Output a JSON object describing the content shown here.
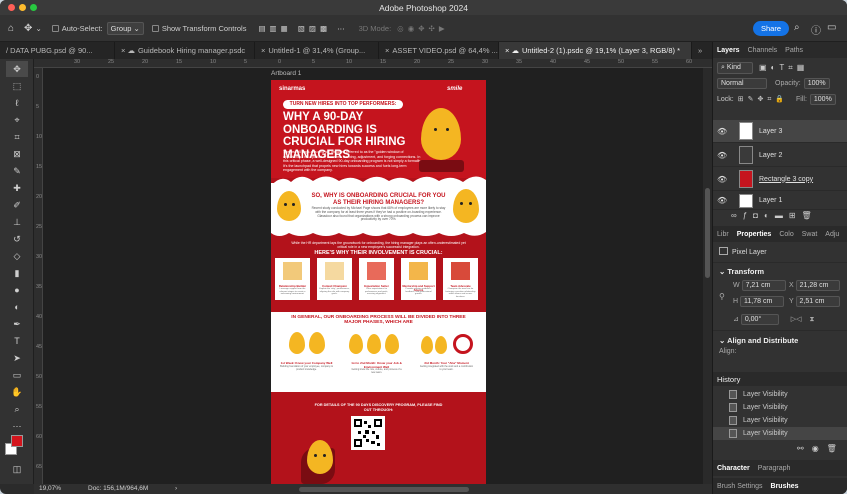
{
  "window": {
    "title": "Adobe Photoshop 2024"
  },
  "options_bar": {
    "auto_select_label": "Auto-Select:",
    "auto_select_value": "Group",
    "transform_label": "Show Transform Controls",
    "mode_3d": "3D Mode:",
    "share_label": "Share"
  },
  "tabs": [
    {
      "label": "/ DATA PUBG.psd @ 90..."
    },
    {
      "label": "Guidebook Hiring manager.psdc"
    },
    {
      "label": "Untitled-1 @ 31,4% (Group..."
    },
    {
      "label": "ASSET VIDEO.psd @ 64,4% ..."
    },
    {
      "label": "Untitled-2 (1).psdc @ 19,1% (Layer 3, RGB/8) *"
    }
  ],
  "ruler": {
    "h": [
      "30",
      "25",
      "20",
      "15",
      "10",
      "5",
      "0",
      "5",
      "10",
      "15",
      "20",
      "25",
      "30",
      "35",
      "40",
      "45",
      "50",
      "55",
      "60"
    ],
    "v": [
      "0",
      "5",
      "10",
      "15",
      "20",
      "25",
      "30",
      "35",
      "40",
      "45",
      "50",
      "55",
      "60",
      "65"
    ]
  },
  "artboard": {
    "label": "Artboard 1"
  },
  "status": {
    "zoom": "19,07%",
    "doc": "Doc: 156,1M/964,6M"
  },
  "poster": {
    "logo_left": "sinarmas",
    "logo_right": "smile",
    "pill": "TURN NEW HIRES INTO TOP PERFORMERS:",
    "title": "WHY A 90-DAY ONBOARDING IS CRUCIAL FOR HIRING MANAGERS",
    "intro": "The first 90 days at a new job are often referred to as the \"golden window of opportunity.\" It's a period of immense learning, adjustment, and forging connections. In this critical phase, a well-designed 90-day onboarding program is not simply a formality. It's the launchpad that propels new hires towards success and fuels long-term engagement with the company.",
    "s2_title": "SO, WHY IS ONBOARDING CRUCIAL FOR YOU AS THEIR HIRING MANAGERS?",
    "s2_body": "Recent study conducted by Michael Page shows that 68% of employees are more likely to stay with the company for at least three years if they've had a positive on-boarding experience. Glassdoor also found that organizations with a strong onboarding process can improve productivity by over 70%.",
    "s3_intro": "While the HR department lays the groundwork for onboarding, the hiring manager plays an often-underestimated yet critical role in a new employee's successful integration.",
    "s3_title": "HERE'S WHY THEIR INVOLVEMENT IS CRUCIAL:",
    "cards": [
      {
        "title": "Relationship Builder",
        "text": "Leverage support from the relevant stages to create a welcoming environment."
      },
      {
        "title": "Context Champion",
        "text": "Explain the 'why', performance, aligning the role with company goals."
      },
      {
        "title": "Expectation Setter",
        "text": "Clear expectations for performance and goals, ensuring alignment."
      },
      {
        "title": "Mentorship and Support Source",
        "text": "Provide ongoing guidance, feedback, and professional growth."
      },
      {
        "title": "Team Advocate",
        "text": "Champion the new hire for fostering a positive relationship within teams and across functions."
      }
    ],
    "s4_title": "IN GENERAL, OUR ONBOARDING PROCESS WILL BE DIVIDED INTO THREE MAJOR PHASES, WHICH ARE",
    "phases": [
      {
        "title": "1st Week: Know your Company Well",
        "text": "Building foundation of your employee, company & product knowledge."
      },
      {
        "title": "1st to 2nd Month: Know your Job & Environment Well",
        "text": "Getting know the role, culture, and process of a new team."
      },
      {
        "title": "3rd Month: Your \"Aha\" Moment",
        "text": "Getting integrated with the work and a contribution to your team."
      }
    ],
    "s5_title": "FOR DETAILS OF THE 90 DAYS DISCOVERY PROGRAM, PLEASE FIND OUT THROUGH:"
  },
  "layers_panel": {
    "tabs": [
      "Layers",
      "Channels",
      "Paths"
    ],
    "kind": "Kind",
    "blend": "Normal",
    "opacity_label": "Opacity:",
    "opacity": "100%",
    "lock_label": "Lock:",
    "fill_label": "Fill:",
    "fill": "100%",
    "layers": [
      {
        "name": "Layer 3",
        "selected": true
      },
      {
        "name": "Layer 2",
        "selected": false
      },
      {
        "name": "Rectangle 3 copy",
        "selected": false
      },
      {
        "name": "Layer 1",
        "selected": false
      }
    ]
  },
  "properties_panel": {
    "tabs": [
      "Libr",
      "Properties",
      "Colo",
      "Swat",
      "Adju"
    ],
    "type": "Pixel Layer",
    "transform_label": "Transform",
    "w_label": "W",
    "w": "7,21 cm",
    "x_label": "X",
    "x": "21,28 cm",
    "h_label": "H",
    "h": "11,78 cm",
    "y_label": "Y",
    "y": "2,51 cm",
    "angle": "0,00°",
    "align_label": "Align and Distribute",
    "align_sub": "Align:"
  },
  "history_panel": {
    "title": "History",
    "items": [
      "Layer Visibility",
      "Layer Visibility",
      "Layer Visibility",
      "Layer Visibility"
    ]
  },
  "bottom_tabs": {
    "character": "Character",
    "paragraph": "Paragraph",
    "brush_settings": "Brush Settings",
    "brushes": "Brushes"
  }
}
